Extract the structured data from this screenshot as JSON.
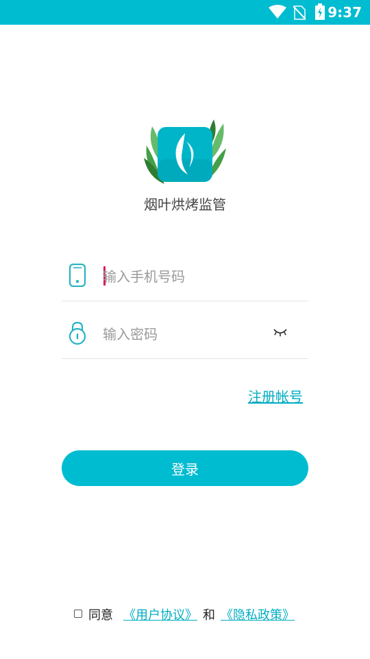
{
  "status_bar": {
    "time": "9:37",
    "icons": [
      "wifi-icon",
      "no-sim-icon",
      "battery-charging-icon"
    ]
  },
  "app": {
    "name": "烟叶烘烤监管",
    "logo_icon": "leaf-flame-logo"
  },
  "login_form": {
    "phone": {
      "placeholder": "输入手机号码",
      "value": "",
      "icon": "phone-icon"
    },
    "password": {
      "placeholder": "输入密码",
      "value": "",
      "icon": "lock-icon",
      "toggle_icon": "eye-closed-icon"
    },
    "register_label": "注册帐号",
    "login_label": "登录"
  },
  "agreement": {
    "checked": false,
    "prefix": "同意",
    "user_agreement": "《用户协议》",
    "and": "和",
    "privacy_policy": "《隐私政策》"
  },
  "colors": {
    "primary": "#00bcd0",
    "link": "#00acc1",
    "leaf": "#4caf50",
    "caret": "#d81b60"
  }
}
